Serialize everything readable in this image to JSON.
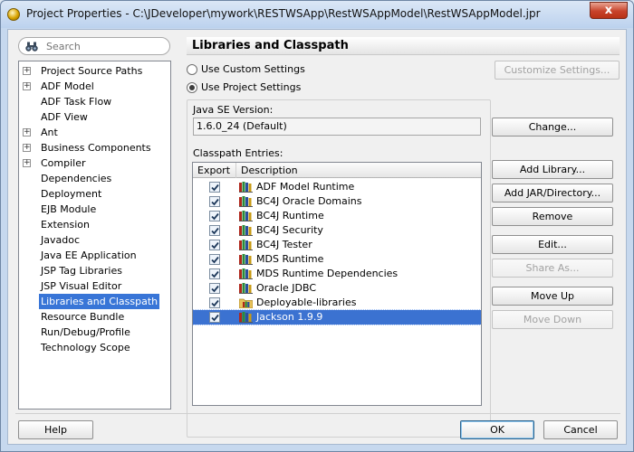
{
  "window": {
    "title": "Project Properties - C:\\JDeveloper\\mywork\\RESTWSApp\\RestWSAppModel\\RestWSAppModel.jpr",
    "close_label": "x"
  },
  "search": {
    "placeholder": "Search"
  },
  "nav": {
    "items": [
      {
        "label": "Project Source Paths",
        "expandable": true
      },
      {
        "label": "ADF Model",
        "expandable": true
      },
      {
        "label": "ADF Task Flow",
        "expandable": false
      },
      {
        "label": "ADF View",
        "expandable": false
      },
      {
        "label": "Ant",
        "expandable": true
      },
      {
        "label": "Business Components",
        "expandable": true
      },
      {
        "label": "Compiler",
        "expandable": true
      },
      {
        "label": "Dependencies",
        "expandable": false
      },
      {
        "label": "Deployment",
        "expandable": false
      },
      {
        "label": "EJB Module",
        "expandable": false
      },
      {
        "label": "Extension",
        "expandable": false
      },
      {
        "label": "Javadoc",
        "expandable": false
      },
      {
        "label": "Java EE Application",
        "expandable": false
      },
      {
        "label": "JSP Tag Libraries",
        "expandable": false
      },
      {
        "label": "JSP Visual Editor",
        "expandable": false
      },
      {
        "label": "Libraries and Classpath",
        "expandable": false,
        "selected": true
      },
      {
        "label": "Resource Bundle",
        "expandable": false
      },
      {
        "label": "Run/Debug/Profile",
        "expandable": false
      },
      {
        "label": "Technology Scope",
        "expandable": false
      }
    ]
  },
  "panel": {
    "title": "Libraries and Classpath",
    "use_custom_label": "Use Custom Settings",
    "use_project_label": "Use Project Settings",
    "selected_setting": "project",
    "customize_label": "Customize Settings...",
    "java_se_label": "Java SE Version:",
    "java_se_value": "1.6.0_24 (Default)",
    "change_label": "Change...",
    "classpath_label": "Classpath Entries:",
    "columns": {
      "export": "Export",
      "description": "Description"
    },
    "entries": [
      {
        "name": "ADF Model Runtime",
        "checked": true,
        "icon": "library-icon"
      },
      {
        "name": "BC4J Oracle Domains",
        "checked": true,
        "icon": "library-icon"
      },
      {
        "name": "BC4J Runtime",
        "checked": true,
        "icon": "library-icon"
      },
      {
        "name": "BC4J Security",
        "checked": true,
        "icon": "library-icon"
      },
      {
        "name": "BC4J Tester",
        "checked": true,
        "icon": "library-icon"
      },
      {
        "name": "MDS Runtime",
        "checked": true,
        "icon": "library-icon"
      },
      {
        "name": "MDS Runtime Dependencies",
        "checked": true,
        "icon": "library-icon"
      },
      {
        "name": "Oracle JDBC",
        "checked": true,
        "icon": "library-icon"
      },
      {
        "name": "Deployable-libraries",
        "checked": true,
        "icon": "folder-library-icon"
      },
      {
        "name": "Jackson 1.9.9",
        "checked": true,
        "icon": "library-icon",
        "selected": true
      }
    ],
    "buttons": {
      "add_library": "Add Library...",
      "add_jar": "Add JAR/Directory...",
      "remove": "Remove",
      "edit": "Edit...",
      "share_as": "Share As...",
      "move_up": "Move Up",
      "move_down": "Move Down"
    }
  },
  "footer": {
    "help": "Help",
    "ok": "OK",
    "cancel": "Cancel"
  }
}
